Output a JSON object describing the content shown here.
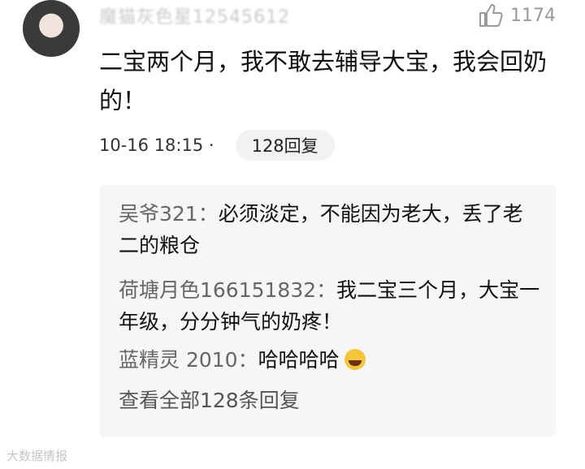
{
  "comment": {
    "username": "魔猫灰色星12545612",
    "like_count": "1174",
    "text": "二宝两个月，我不敢去辅导大宝，我会回奶的！",
    "timestamp": "10-16 18:15 ·",
    "reply_button": "128回复"
  },
  "replies": [
    {
      "name": "吴爷321",
      "sep": "：",
      "text": "必须淡定，不能因为老大，丢了老二的粮仓"
    },
    {
      "name": "荷塘月色166151832",
      "sep": "：",
      "text": "我二宝三个月，大宝一年级，分分钟气的奶疼！"
    },
    {
      "name": "蓝精灵 2010",
      "sep": "：",
      "text": "哈哈哈哈"
    }
  ],
  "view_all": "查看全部128条回复",
  "watermark": "大数据情报"
}
